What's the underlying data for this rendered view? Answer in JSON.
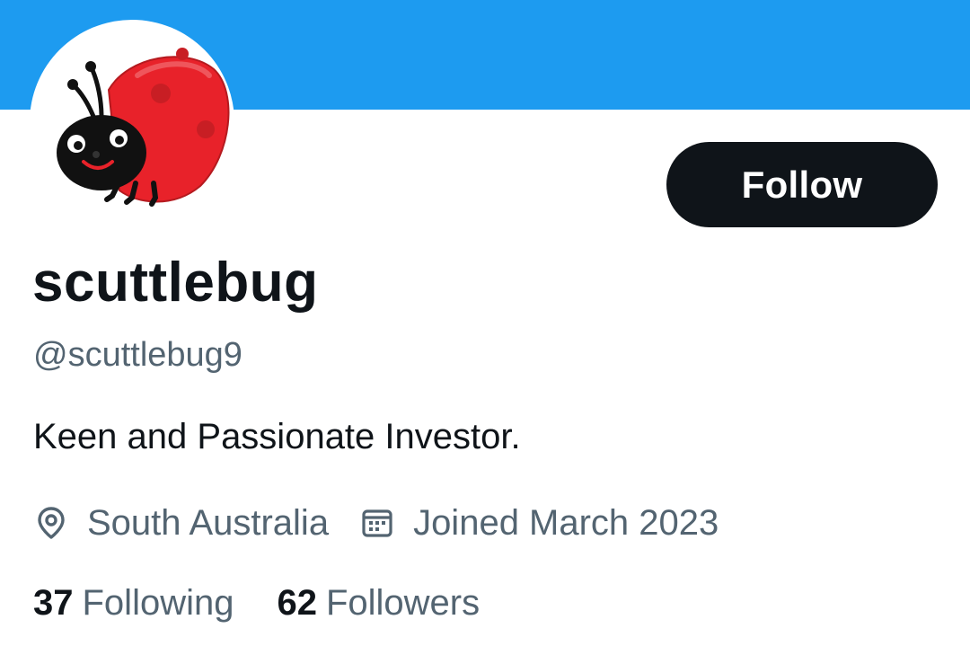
{
  "profile": {
    "display_name": "scuttlebug",
    "handle": "@scuttlebug9",
    "bio": "Keen and Passionate Investor.",
    "location": "South Australia",
    "joined": "Joined March 2023",
    "avatar_icon": "ladybug-avatar"
  },
  "actions": {
    "follow_label": "Follow"
  },
  "stats": {
    "following_count": "37",
    "following_label": "Following",
    "followers_count": "62",
    "followers_label": "Followers"
  },
  "icons": {
    "location": "location-pin-icon",
    "calendar": "calendar-icon"
  },
  "colors": {
    "banner": "#1d9bf0",
    "text_primary": "#0f1419",
    "text_secondary": "#536471",
    "button_bg": "#0f1419",
    "ladybug_red": "#e8222a"
  }
}
